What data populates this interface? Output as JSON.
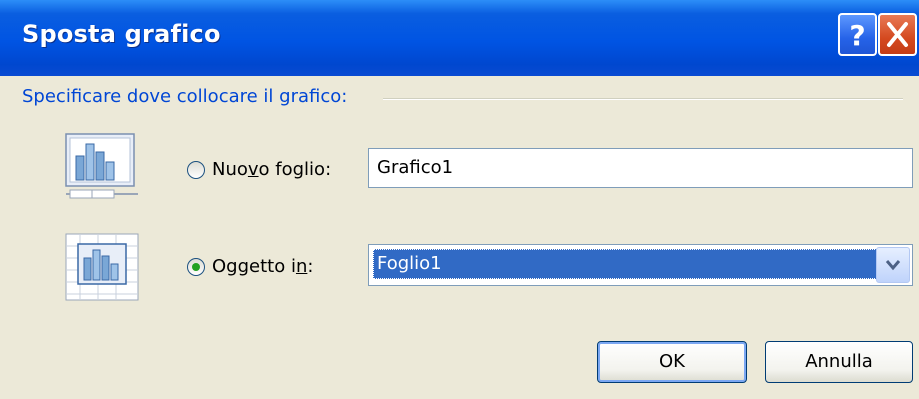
{
  "window": {
    "title": "Sposta grafico"
  },
  "titlebar": {
    "help_icon": "question-mark",
    "close_icon": "x-mark"
  },
  "group": {
    "label": "Specificare dove collocare il grafico:"
  },
  "options": {
    "new_sheet": {
      "label_pre": "Nuo",
      "label_accel": "v",
      "label_post": "o foglio:",
      "value": "Grafico1",
      "selected": false,
      "icon": "chart-new-sheet-icon"
    },
    "object_in": {
      "label_pre": "Oggetto i",
      "label_accel": "n",
      "label_post": ":",
      "value": "Foglio1",
      "selected": true,
      "icon": "chart-embedded-icon"
    }
  },
  "buttons": {
    "ok": "OK",
    "cancel": "Annulla"
  },
  "colors": {
    "title_bar": "#0054e3",
    "dialog_bg": "#ece9d8",
    "group_label": "#0046d5",
    "selection": "#316ac5",
    "radio_dot": "#21a121"
  }
}
